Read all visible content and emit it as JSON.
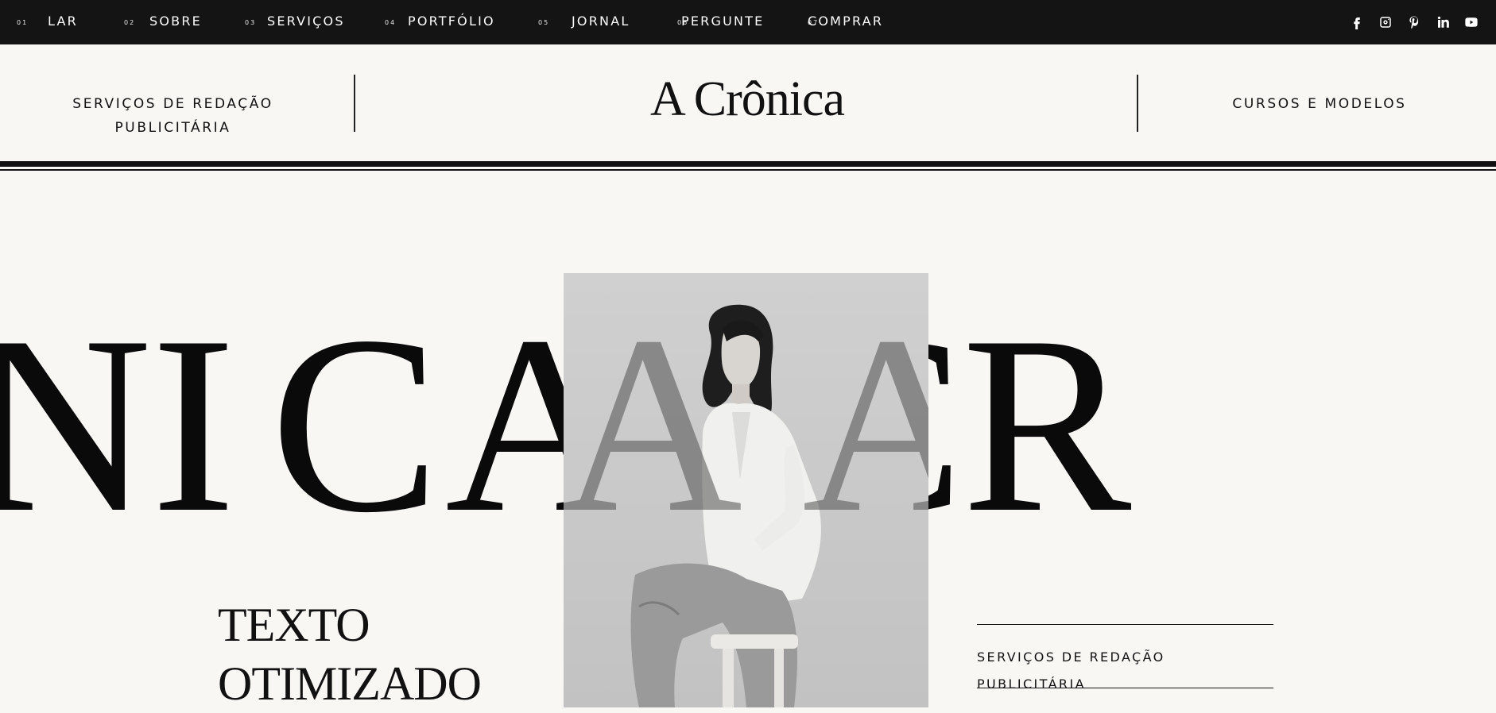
{
  "nav": {
    "items": [
      {
        "num": "01",
        "label": "LAR"
      },
      {
        "num": "02",
        "label": "SOBRE"
      },
      {
        "num": "03",
        "label": "SERVIÇOS"
      },
      {
        "num": "04",
        "label": "PORTFÓLIO"
      },
      {
        "num": "05",
        "label": "JORNAL"
      },
      {
        "num": "06",
        "label": "PERGUNTE"
      },
      {
        "num": "07",
        "label": "COMPRAR"
      }
    ],
    "socials": [
      "facebook-icon",
      "instagram-icon",
      "pinterest-icon",
      "linkedin-icon",
      "youtube-icon"
    ]
  },
  "masthead": {
    "left_line1": "SERVIÇOS DE REDAÇÃO",
    "left_line2": "PUBLICITÁRIA",
    "title": "A Crônica",
    "right": "CURSOS E MODELOS"
  },
  "hero": {
    "marquee": "NICA A CR",
    "headline_line1": "TEXTO",
    "headline_line2": "OTIMIZADO",
    "side_line1": "SERVIÇOS DE REDAÇÃO",
    "side_line2": "PUBLICITÁRIA"
  }
}
